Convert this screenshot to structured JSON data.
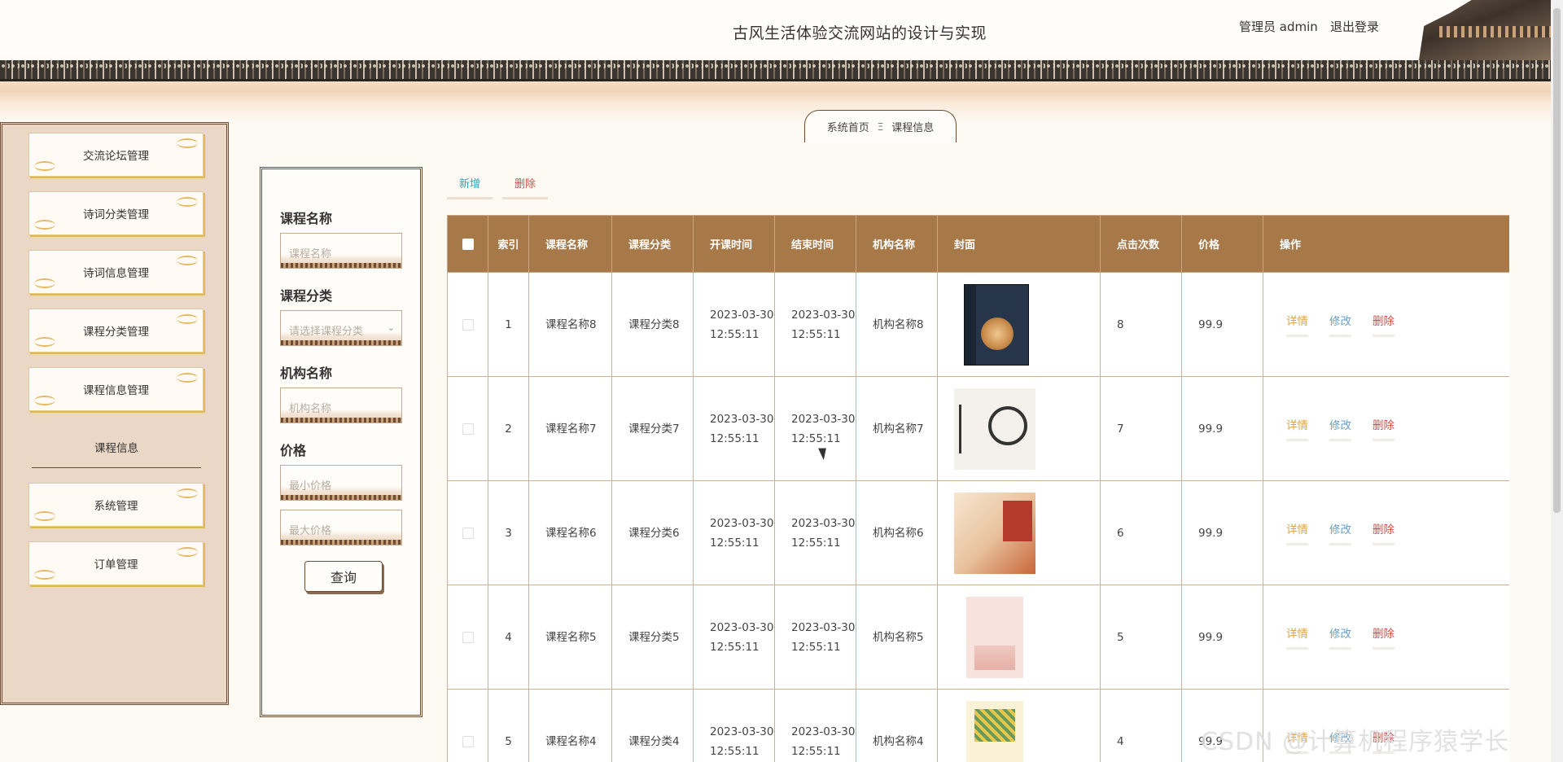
{
  "header": {
    "title": "古风生活体验交流网站的设计与实现",
    "user_text": "管理员 admin",
    "logout_label": "退出登录"
  },
  "breadcrumb": {
    "home": "系统首页",
    "separator": "Ξ",
    "current": "课程信息"
  },
  "sidebar": {
    "items": [
      {
        "label": "交流论坛管理"
      },
      {
        "label": "诗词分类管理"
      },
      {
        "label": "诗词信息管理"
      },
      {
        "label": "课程分类管理"
      },
      {
        "label": "课程信息管理"
      }
    ],
    "active_sub": "课程信息",
    "items2": [
      {
        "label": "系统管理"
      },
      {
        "label": "订单管理"
      }
    ]
  },
  "search": {
    "course_name_label": "课程名称",
    "course_name_placeholder": "课程名称",
    "category_label": "课程分类",
    "category_placeholder": "请选择课程分类",
    "org_label": "机构名称",
    "org_placeholder": "机构名称",
    "price_label": "价格",
    "min_price_placeholder": "最小价格",
    "max_price_placeholder": "最大价格",
    "query_button": "查询"
  },
  "actions": {
    "add_label": "新增",
    "delete_label": "删除"
  },
  "table": {
    "columns": [
      "索引",
      "课程名称",
      "课程分类",
      "开课时间",
      "结束时间",
      "机构名称",
      "封面",
      "点击次数",
      "价格",
      "操作"
    ],
    "op_labels": {
      "detail": "详情",
      "edit": "修改",
      "delete": "删除"
    },
    "rows": [
      {
        "index": "1",
        "name": "课程名称8",
        "category": "课程分类8",
        "start": "2023-03-30 12:55:11",
        "end": "2023-03-30 12:55:11",
        "org": "机构名称8",
        "clicks": "8",
        "price": "99.9"
      },
      {
        "index": "2",
        "name": "课程名称7",
        "category": "课程分类7",
        "start": "2023-03-30 12:55:11",
        "end": "2023-03-30 12:55:11",
        "org": "机构名称7",
        "clicks": "7",
        "price": "99.9"
      },
      {
        "index": "3",
        "name": "课程名称6",
        "category": "课程分类6",
        "start": "2023-03-30 12:55:11",
        "end": "2023-03-30 12:55:11",
        "org": "机构名称6",
        "clicks": "6",
        "price": "99.9"
      },
      {
        "index": "4",
        "name": "课程名称5",
        "category": "课程分类5",
        "start": "2023-03-30 12:55:11",
        "end": "2023-03-30 12:55:11",
        "org": "机构名称5",
        "clicks": "5",
        "price": "99.9"
      },
      {
        "index": "5",
        "name": "课程名称4",
        "category": "课程分类4",
        "start": "2023-03-30 12:55:11",
        "end": "2023-03-30 12:55:11",
        "org": "机构名称4",
        "clicks": "4",
        "price": "99.9"
      }
    ]
  },
  "watermark": "CSDN @计算机程序猿学长"
}
